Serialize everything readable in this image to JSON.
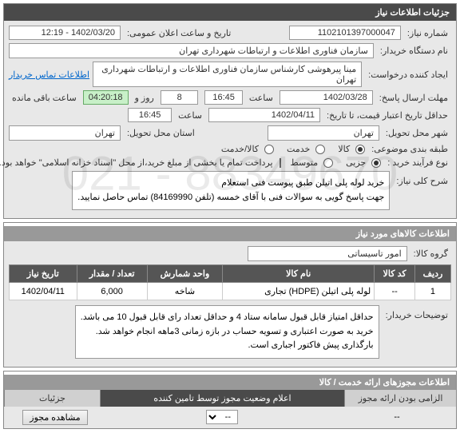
{
  "panel1": {
    "title": "جزئیات اطلاعات نیاز",
    "need_number_label": "شماره نیاز:",
    "need_number": "1102101397000047",
    "announce_label": "تاریخ و ساعت اعلان عمومی:",
    "announce_value": "1402/03/20 - 12:19",
    "buyer_label": "نام دستگاه خریدار:",
    "buyer_value": "سازمان فناوری اطلاعات و ارتباطات شهرداری تهران",
    "requester_label": "ایجاد کننده درخواست:",
    "requester_value": "مینا پیرهوشی کارشناس سازمان فناوری اطلاعات و ارتباطات شهرداری تهران",
    "buyer_contact_link": "اطلاعات تماس خریدار",
    "deadline_label": "مهلت ارسال پاسخ:",
    "deadline_date": "1402/03/28",
    "time_label": "ساعت",
    "deadline_time": "16:45",
    "days": "8",
    "days_label": "روز و",
    "remaining_time": "04:20:18",
    "remaining_label": "ساعت باقی مانده",
    "credit_label": "حداقل تاریخ اعتبار قیمت، تا تاریخ:",
    "credit_date": "1402/04/11",
    "credit_time": "16:45",
    "delivery_city_label": "شهر محل تحویل:",
    "delivery_city": "تهران",
    "delivery_province_label": "استان محل تحویل:",
    "delivery_province": "تهران",
    "subject_class_label": "طبقه بندی موضوعی:",
    "class_goods": "کالا",
    "class_service": "خدمت",
    "class_both": "کالا/خدمت",
    "purchase_type_label": "نوع فرآیند خرید :",
    "type_minor": "جزیی",
    "type_medium": "متوسط",
    "islamic_note": "پرداخت تمام یا بخشی از مبلغ خرید،از محل \"اسناد خزانه اسلامی\" خواهد بود.",
    "description_label": "شرح کلی نیاز:",
    "description_line1": "خرید لوله پلی اتیلن طبق پیوست فنی استعلام",
    "description_line2": "جهت پاسخ گویی به سوالات فنی با آقای خمسه (تلفن 84169990) تماس حاصل نمایید."
  },
  "panel2": {
    "title": "اطلاعات کالاهای مورد نیاز",
    "group_label": "گروه کالا:",
    "group_value": "امور تاسیساتی",
    "headers": {
      "row": "ردیف",
      "code": "کد کالا",
      "name": "نام کالا",
      "unit": "واحد شمارش",
      "qty": "تعداد / مقدار",
      "date": "تاریخ نیاز"
    },
    "item": {
      "row": "1",
      "code": "--",
      "name": "لوله پلی اتیلن (HDPE) تجاری",
      "unit": "شاخه",
      "qty": "6,000",
      "date": "1402/04/11"
    },
    "notes_label": "توضیحات خریدار:",
    "notes_line1": "حداقل امتیاز قابل قبول سامانه ستاد 4 و حداقل تعداد رای قابل قبول 10 می باشد.",
    "notes_line2": "خرید به صورت اعتباری و تسویه حساب در بازه زمانی 3ماهه انجام خواهد شد.",
    "notes_line3": "بارگذاری پیش فاکتور اجباری است."
  },
  "panel3": {
    "title": "اطلاعات مجوزهای ارائه خدمت / کالا",
    "col_required": "الزامی بودن ارائه مجوز",
    "col_declare": "اعلام وضعیت مجوز توسط تامین کننده",
    "col_details": "جزئیات",
    "placeholder": "--",
    "btn_view": "مشاهده مجوز"
  }
}
